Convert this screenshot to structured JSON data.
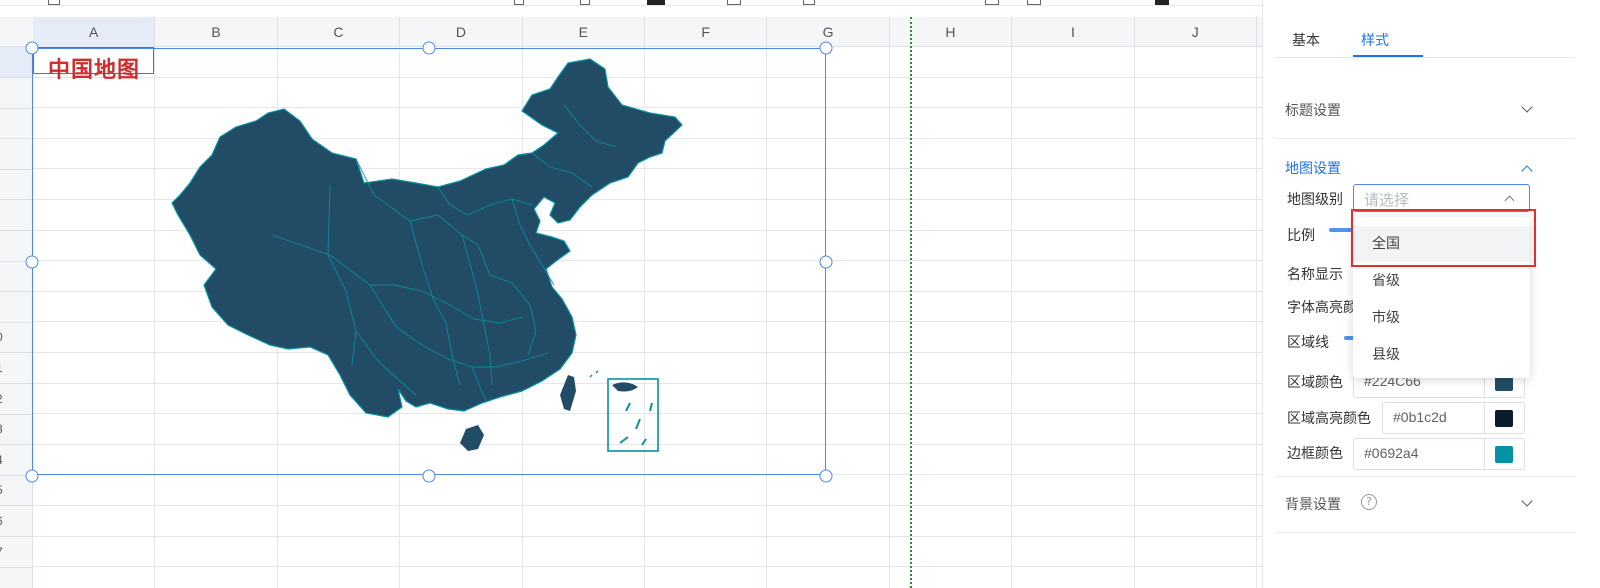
{
  "sheet": {
    "columns": [
      "A",
      "B",
      "C",
      "D",
      "E",
      "F",
      "G",
      "H",
      "I",
      "J"
    ],
    "row_numbers": [
      "",
      "",
      "",
      "",
      "",
      "",
      "",
      "",
      "",
      "0",
      "1",
      "2",
      "3",
      "4",
      "5",
      "6",
      "7"
    ]
  },
  "chart": {
    "title": "中国地图",
    "map_fill_color": "#224C66",
    "map_border_color": "#0692a4"
  },
  "panel": {
    "tabs": {
      "basic": "基本",
      "style": "样式"
    },
    "title_settings": "标题设置",
    "map_settings": "地图设置",
    "map_level_label": "地图级别",
    "map_level_placeholder": "请选择",
    "scale_label": "比例",
    "name_display_label": "名称显示",
    "font_highlight_label": "字体高亮颜",
    "region_line_label": "区域线",
    "region_color_label": "区域颜色",
    "region_color_value": "#224C66",
    "region_highlight_label": "区域高亮颜色",
    "region_highlight_value": "#0b1c2d",
    "border_color_label": "边框颜色",
    "border_color_value": "#0692a4",
    "background_settings": "背景设置",
    "help_symbol": "?",
    "dropdown_options": [
      "全国",
      "省级",
      "市级",
      "县级"
    ],
    "accent_color": "#1d74e8",
    "highlight_box_color": "#e0302c"
  }
}
